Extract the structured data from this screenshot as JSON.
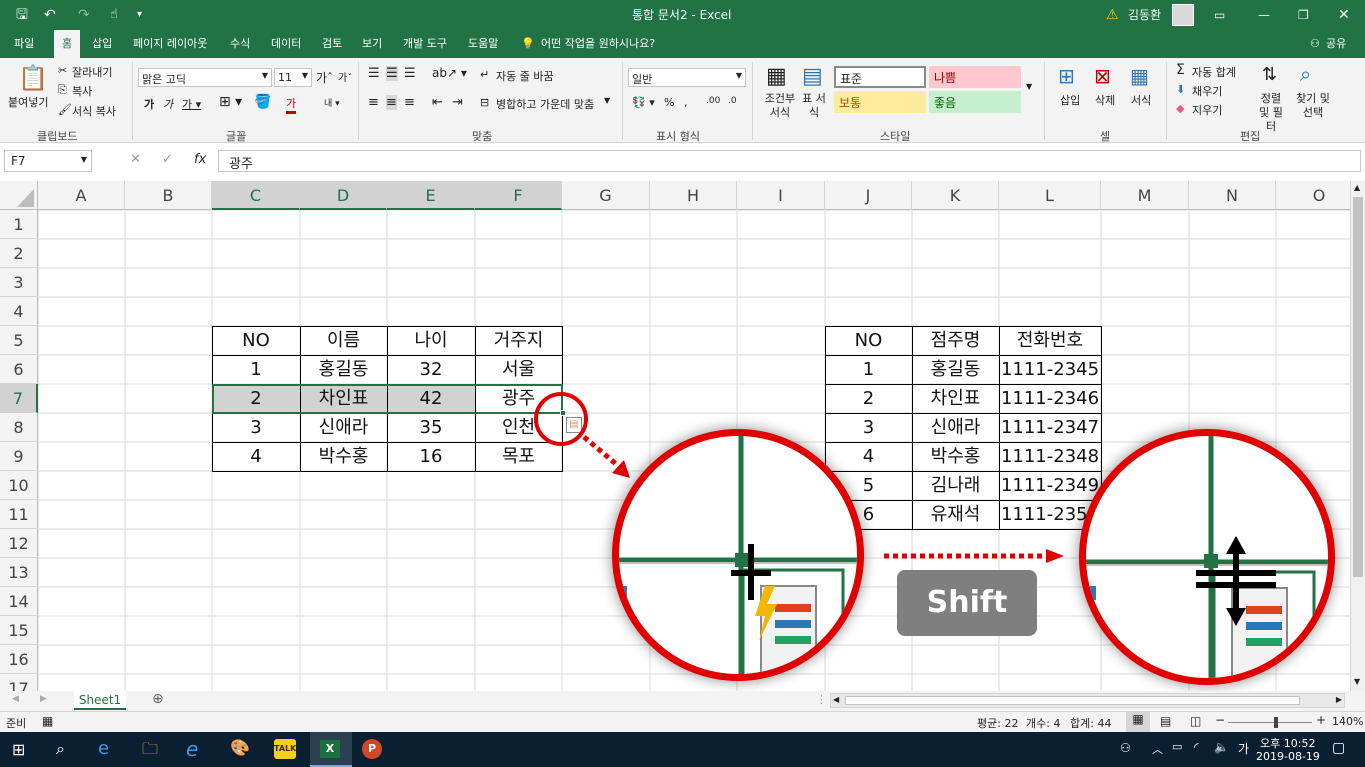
{
  "window": {
    "title": "통합 문서2 - Excel",
    "user": "김동환"
  },
  "ribbon_tabs": [
    "파일",
    "홈",
    "삽입",
    "페이지 레이아웃",
    "수식",
    "데이터",
    "검토",
    "보기",
    "개발 도구",
    "도움말"
  ],
  "tell_me": "어떤 작업을 원하시나요?",
  "share": "공유",
  "clipboard": {
    "paste": "붙여넣기",
    "cut": "잘라내기",
    "copy": "복사",
    "format_painter": "서식 복사",
    "label": "클립보드"
  },
  "font": {
    "name": "맑은 고딕",
    "size": "11",
    "label": "글꼴"
  },
  "alignment": {
    "wrap": "자동 줄 바꿈",
    "merge": "병합하고 가운데 맞춤",
    "label": "맞춤"
  },
  "number": {
    "format": "일반",
    "label": "표시 형식"
  },
  "styles": {
    "conditional": "조건부 서식",
    "table": "표 서식",
    "normal": "표준",
    "bad": "나쁨",
    "neutral": "보통",
    "good": "좋음",
    "label": "스타일"
  },
  "cells": {
    "insert": "삽입",
    "delete": "삭제",
    "format": "서식",
    "label": "셀"
  },
  "editing": {
    "autosum": "자동 합계",
    "fill": "채우기",
    "clear": "지우기",
    "sort": "정렬 및 필터",
    "find": "찾기 및 선택",
    "label": "편집"
  },
  "formula_bar": {
    "name_box": "F7",
    "fx": "fx",
    "value": "광주"
  },
  "columns": [
    "A",
    "B",
    "C",
    "D",
    "E",
    "F",
    "G",
    "H",
    "I",
    "J",
    "K",
    "L",
    "M",
    "N",
    "O"
  ],
  "rows": [
    "1",
    "2",
    "3",
    "4",
    "5",
    "6",
    "7",
    "8",
    "9",
    "10",
    "11",
    "12",
    "13",
    "14",
    "15",
    "16",
    "17"
  ],
  "table1": {
    "headers": [
      "NO",
      "이름",
      "나이",
      "거주지"
    ],
    "rows": [
      [
        "1",
        "홍길동",
        "32",
        "서울"
      ],
      [
        "2",
        "차인표",
        "42",
        "광주"
      ],
      [
        "3",
        "신애라",
        "35",
        "인천"
      ],
      [
        "4",
        "박수홍",
        "16",
        "목포"
      ]
    ]
  },
  "table2": {
    "headers": [
      "NO",
      "점주명",
      "전화번호"
    ],
    "rows": [
      [
        "1",
        "홍길동",
        "1111-2345"
      ],
      [
        "2",
        "차인표",
        "1111-2346"
      ],
      [
        "3",
        "신애라",
        "1111-2347"
      ],
      [
        "4",
        "박수홍",
        "1111-2348"
      ],
      [
        "5",
        "김나래",
        "1111-2349"
      ],
      [
        "6",
        "유재석",
        "1111-2350"
      ]
    ]
  },
  "overlay": {
    "shift_label": "Shift",
    "accent_color": "#e00000"
  },
  "sheet_tab": "Sheet1",
  "status": {
    "ready": "준비",
    "average": "평균: 22",
    "count": "개수: 4",
    "sum": "합계: 44",
    "zoom": "140%"
  },
  "taskbar": {
    "time": "오후 10:52",
    "date": "2019-08-19",
    "ime": "가"
  },
  "colors": {
    "excel_green": "#217346",
    "bad_bg": "#ffc7ce",
    "neutral_bg": "#ffeb9c",
    "good_bg": "#c6efce"
  }
}
